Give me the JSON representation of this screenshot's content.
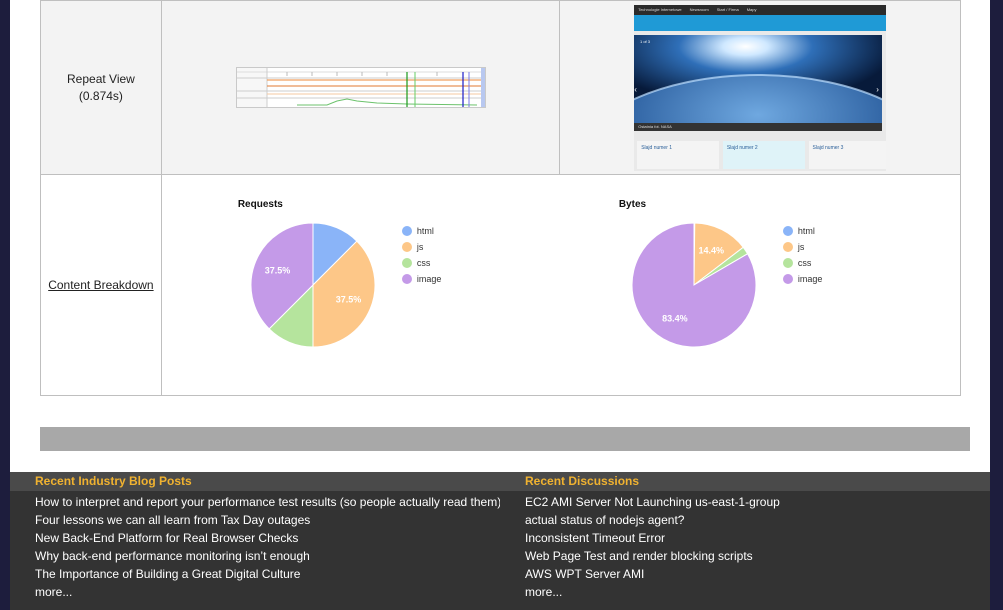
{
  "table": {
    "repeat_view_label": "Repeat View",
    "repeat_view_time": "(0.874s)",
    "content_breakdown_label": "Content Breakdown"
  },
  "screenshot_thumb": {
    "nav_brand": "Technologie Internetowe",
    "nav_items": [
      "Newsroom",
      "Start / Firma",
      "Mapy"
    ],
    "slide_counter": "1 of 3",
    "caption": "Ostatnia fot. NASA",
    "slides": [
      "Slajd numer 1",
      "Slajd numer 2",
      "Slajd numer 3"
    ]
  },
  "chart_data": [
    {
      "type": "pie",
      "title": "Requests",
      "labels": [
        "html",
        "js",
        "css",
        "image"
      ],
      "values": [
        12.5,
        37.5,
        12.5,
        37.5
      ],
      "data_labels": [
        "",
        "37.5%",
        "",
        "37.5%"
      ],
      "colors": [
        "#8ab4f8",
        "#fdc788",
        "#b5e49d",
        "#c49ae8"
      ],
      "legend": "right"
    },
    {
      "type": "pie",
      "title": "Bytes",
      "labels": [
        "html",
        "js",
        "css",
        "image"
      ],
      "values": [
        0.2,
        14.4,
        2.0,
        83.4
      ],
      "data_labels": [
        "",
        "14.4%",
        "",
        "83.4%"
      ],
      "colors": [
        "#8ab4f8",
        "#fdc788",
        "#b5e49d",
        "#c49ae8"
      ],
      "legend": "right"
    }
  ],
  "footer": {
    "blog_title": "Recent Industry Blog Posts",
    "blog_posts": [
      "How to interpret and report your performance test results (so people actually read them)",
      "Four lessons we can all learn from Tax Day outages",
      "New Back-End Platform for Real Browser Checks",
      "Why back-end performance monitoring isn’t enough",
      "The Importance of Building a Great Digital Culture"
    ],
    "blog_more": "more...",
    "discussions_title": "Recent Discussions",
    "discussions": [
      "EC2 AMI Server Not Launching us-east-1-group",
      "actual status of nodejs agent?",
      "Inconsistent Timeout Error",
      "Web Page Test and render blocking scripts",
      "AWS WPT Server AMI"
    ],
    "discussions_more": "more..."
  }
}
